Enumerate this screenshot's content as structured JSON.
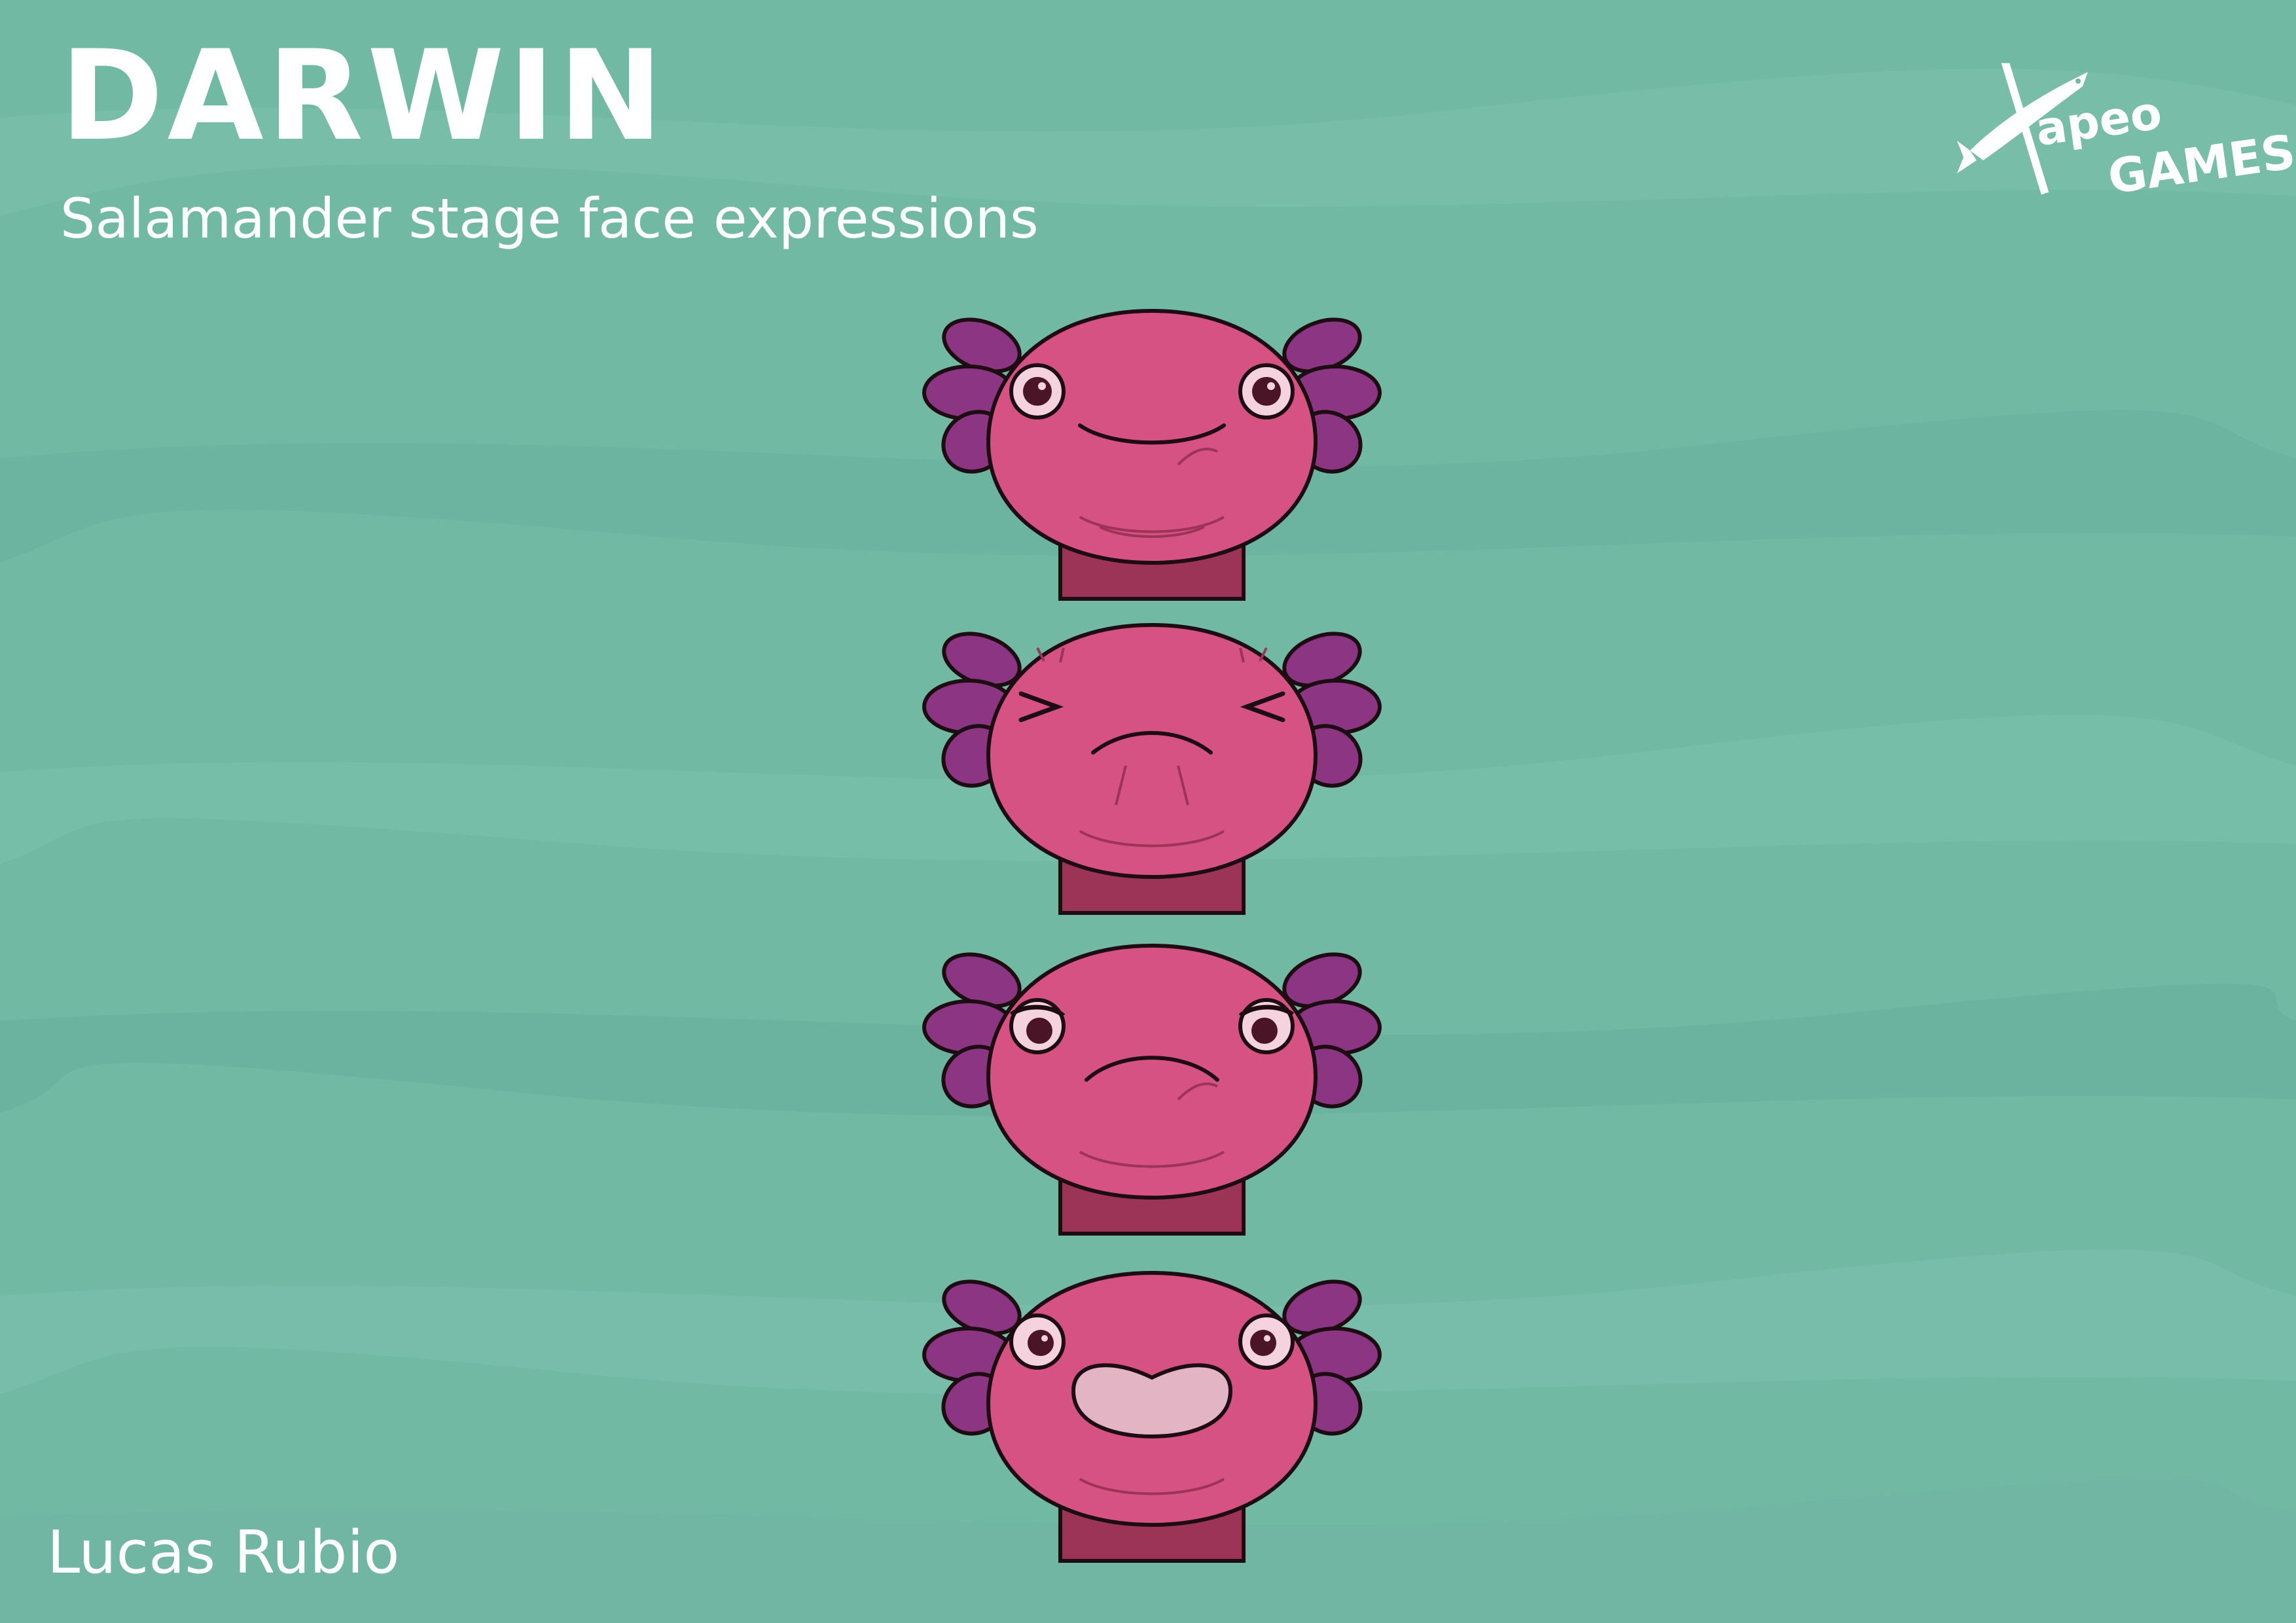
{
  "header": {
    "title": "DARWIN",
    "subtitle": "Salamander stage face expressions"
  },
  "credit": {
    "author": "Lucas Rubio"
  },
  "logo": {
    "line1": "apeo",
    "line2": "GAMES"
  },
  "faces": [
    {
      "expression": "smile"
    },
    {
      "expression": "squint"
    },
    {
      "expression": "annoyed"
    },
    {
      "expression": "grin"
    }
  ],
  "colors": {
    "background": "#72b9a4",
    "skin": "#d65283",
    "skin_shadow": "#9b3457",
    "gills": "#8c3683",
    "outline": "#1d0d12",
    "eye_white": "#f4d2de",
    "teeth": "#e3b4c3"
  }
}
